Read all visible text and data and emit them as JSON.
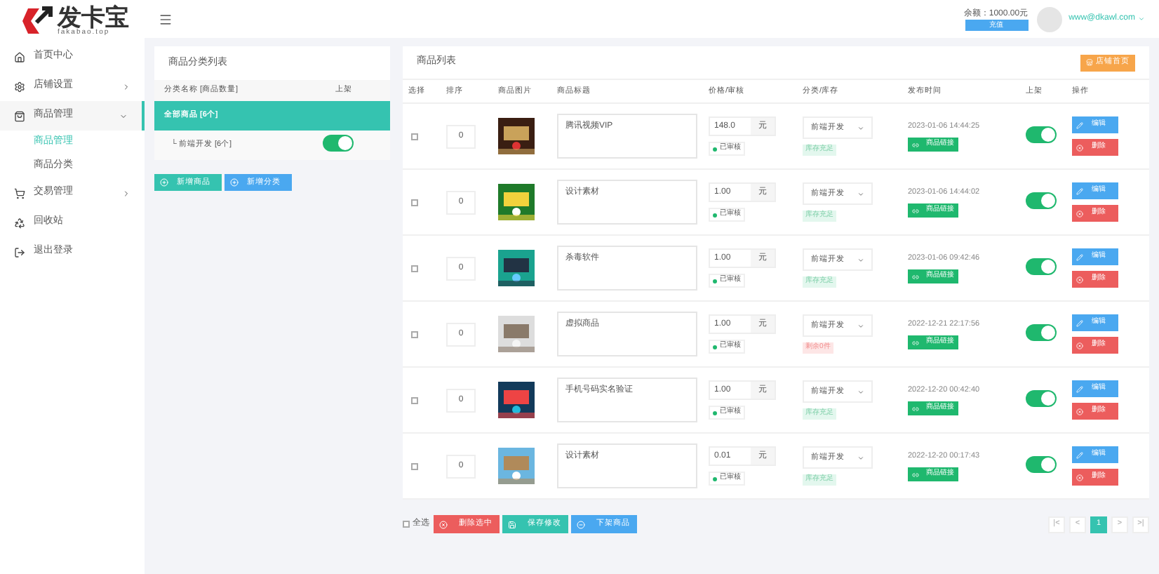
{
  "logo": {
    "name": "发卡宝",
    "domain": "fakabao.top"
  },
  "sidebar": {
    "items": [
      {
        "label": "首页中心",
        "selected": false
      },
      {
        "label": "店铺设置",
        "expanded": false,
        "selected": false
      },
      {
        "label": "商品管理",
        "expanded": true,
        "selected": true,
        "children": [
          {
            "label": "商品管理",
            "selected": true
          },
          {
            "label": "商品分类",
            "selected": false
          }
        ]
      },
      {
        "label": "交易管理",
        "expanded": false,
        "selected": false
      },
      {
        "label": "回收站",
        "selected": false
      },
      {
        "label": "退出登录",
        "selected": false
      }
    ]
  },
  "header": {
    "balance": "余额：1000.00元",
    "recharge": "充值",
    "user": "www@dkawl.com"
  },
  "categories": {
    "title": "商品分类列表",
    "columns": [
      "分类名称 [商品数量]",
      "上架"
    ],
    "rows": [
      {
        "label": "全部商品 [6个]",
        "selected": true
      },
      {
        "label": "└ 前端开发 [6个]",
        "selected": false,
        "on": true
      }
    ],
    "buttons": [
      "新增商品",
      "新增分类"
    ]
  },
  "products": {
    "title": "商品列表",
    "shop_button": "店铺首页",
    "columns": [
      "选择",
      "排序",
      "商品图片",
      "商品标题",
      "价格/审核",
      "分类/库存",
      "发布时间",
      "上架",
      "操作"
    ],
    "rows": [
      {
        "checked": false,
        "order": "0",
        "title": "腾讯视频VIP",
        "price": "148.0",
        "unit": "元",
        "audit": "已审核",
        "category": "前端开发",
        "stock": "库存充足",
        "stock_ok": true,
        "time": "2023-01-06 14:44:25",
        "link_label": "商品链接",
        "on": true,
        "edit": "编辑",
        "delete": "删除"
      },
      {
        "checked": false,
        "order": "0",
        "title": "设计素材",
        "price": "1.00",
        "unit": "元",
        "audit": "已审核",
        "category": "前端开发",
        "stock": "库存充足",
        "stock_ok": true,
        "time": "2023-01-06 14:44:02",
        "link_label": "商品链接",
        "on": true,
        "edit": "编辑",
        "delete": "删除"
      },
      {
        "checked": false,
        "order": "0",
        "title": "杀毒软件",
        "price": "1.00",
        "unit": "元",
        "audit": "已审核",
        "category": "前端开发",
        "stock": "库存充足",
        "stock_ok": true,
        "time": "2023-01-06 09:42:46",
        "link_label": "商品链接",
        "on": true,
        "edit": "编辑",
        "delete": "删除"
      },
      {
        "checked": false,
        "order": "0",
        "title": "虚拟商品",
        "price": "1.00",
        "unit": "元",
        "audit": "已审核",
        "category": "前端开发",
        "stock": "剩余0件",
        "stock_ok": false,
        "time": "2022-12-21 22:17:56",
        "link_label": "商品链接",
        "on": true,
        "edit": "编辑",
        "delete": "删除"
      },
      {
        "checked": false,
        "order": "0",
        "title": "手机号码实名验证",
        "price": "1.00",
        "unit": "元",
        "audit": "已审核",
        "category": "前端开发",
        "stock": "库存充足",
        "stock_ok": true,
        "time": "2022-12-20 00:42:40",
        "link_label": "商品链接",
        "on": true,
        "edit": "编辑",
        "delete": "删除"
      },
      {
        "checked": false,
        "order": "0",
        "title": "设计素材",
        "price": "0.01",
        "unit": "元",
        "audit": "已审核",
        "category": "前端开发",
        "stock": "库存充足",
        "stock_ok": true,
        "time": "2022-12-20 00:17:43",
        "link_label": "商品链接",
        "on": true,
        "edit": "编辑",
        "delete": "删除"
      }
    ]
  },
  "footer": {
    "select_all": "全选",
    "select_all_checked": false,
    "buttons": [
      {
        "label": "删除选中",
        "kind": "delete"
      },
      {
        "label": "保存修改",
        "kind": "save"
      },
      {
        "label": "下架商品",
        "kind": "off"
      }
    ],
    "pages": [
      {
        "label": "|<",
        "selected": false
      },
      {
        "label": "<",
        "selected": false
      },
      {
        "label": "1",
        "selected": true
      },
      {
        "label": ">",
        "selected": false
      },
      {
        "label": ">|",
        "selected": false
      }
    ]
  }
}
